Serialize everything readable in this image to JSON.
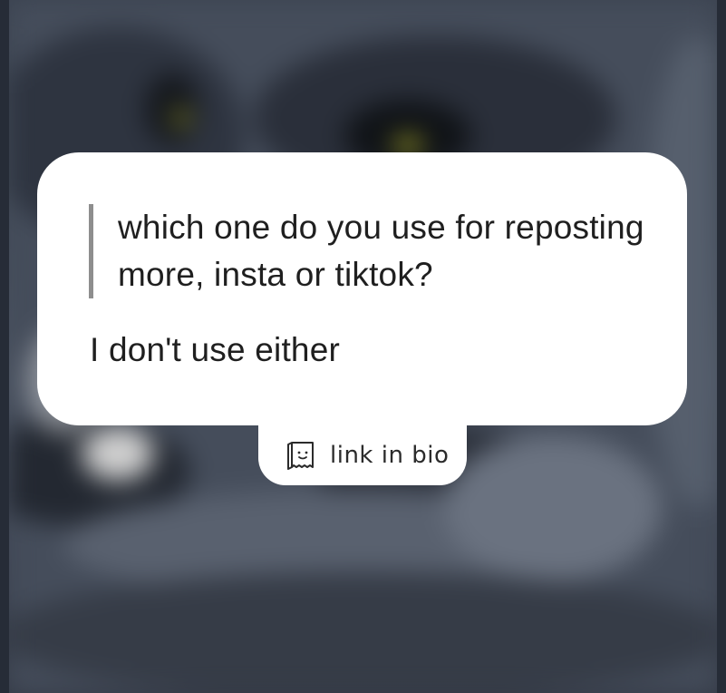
{
  "post": {
    "question": "which one do you use for reposting more, insta or tiktok?",
    "answer": "I don't use either"
  },
  "link_tab": {
    "label": "link in bio",
    "icon": "ghost-card-icon"
  },
  "colors": {
    "card_background": "#ffffff",
    "quote_bar": "#8e8e8e",
    "text": "#1f1f1f",
    "backdrop": "#3f4653"
  }
}
